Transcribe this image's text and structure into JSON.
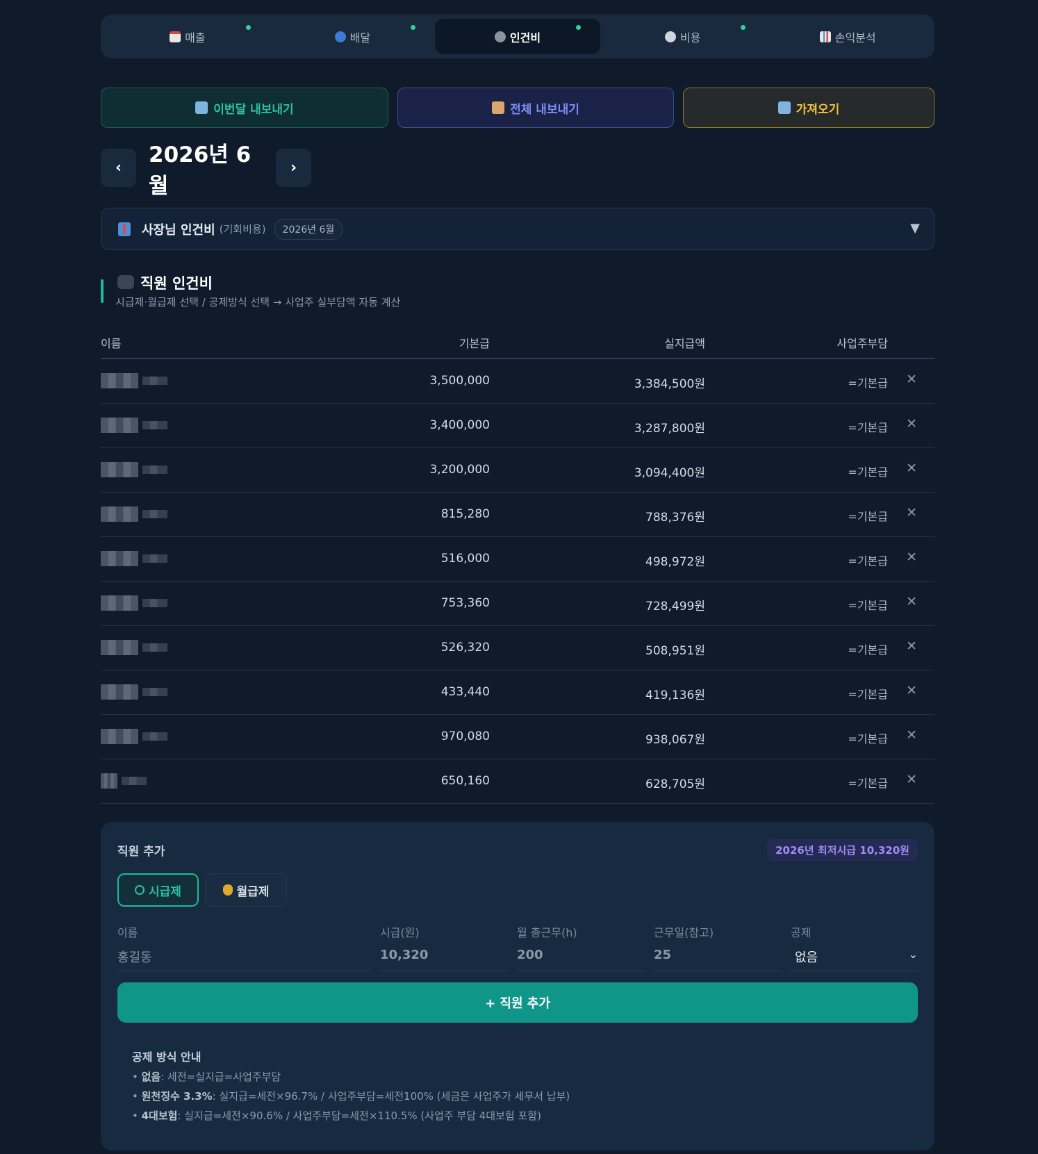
{
  "nav": {
    "tabs": [
      {
        "label": "매출",
        "active": false,
        "dot": true,
        "icon": "calendar-icon"
      },
      {
        "label": "배달",
        "active": false,
        "dot": true,
        "icon": "scooter-icon"
      },
      {
        "label": "인건비",
        "active": true,
        "dot": true,
        "icon": "people-icon"
      },
      {
        "label": "비용",
        "active": false,
        "dot": true,
        "icon": "gear-icon"
      },
      {
        "label": "손익분석",
        "active": false,
        "dot": false,
        "icon": "chart-icon"
      }
    ]
  },
  "actions": {
    "export_month": "이번달 내보내기",
    "export_all": "전체 내보내기",
    "import": "가져오기"
  },
  "month": {
    "prev": "‹",
    "label": "2026년 6월",
    "next": "›"
  },
  "owner": {
    "title": "사장님 인건비",
    "sub": "(기회비용)",
    "badge": "2026년 6월",
    "caret": "▼"
  },
  "staff_section": {
    "title": "직원 인건비",
    "subtitle": "시급제·월급제 선택 / 공제방식 선택 → 사업주 실부담액 자동 계산"
  },
  "table": {
    "headers": {
      "name": "이름",
      "base": "기본급",
      "net": "실지급액",
      "employer": "사업주부담"
    },
    "rows": [
      {
        "base": "3,500,000",
        "net": "3,384,500원",
        "employer": "=기본급"
      },
      {
        "base": "3,400,000",
        "net": "3,287,800원",
        "employer": "=기본급"
      },
      {
        "base": "3,200,000",
        "net": "3,094,400원",
        "employer": "=기본급"
      },
      {
        "base": "815,280",
        "net": "788,376원",
        "employer": "=기본급"
      },
      {
        "base": "516,000",
        "net": "498,972원",
        "employer": "=기본급"
      },
      {
        "base": "753,360",
        "net": "728,499원",
        "employer": "=기본급"
      },
      {
        "base": "526,320",
        "net": "508,951원",
        "employer": "=기본급"
      },
      {
        "base": "433,440",
        "net": "419,136원",
        "employer": "=기본급"
      },
      {
        "base": "970,080",
        "net": "938,067원",
        "employer": "=기본급"
      },
      {
        "base": "650,160",
        "net": "628,705원",
        "employer": "=기본급"
      }
    ],
    "delete_glyph": "✕"
  },
  "add_form": {
    "title": "직원 추가",
    "min_wage": "2026년 최저시급 10,320원",
    "mode_hourly": "시급제",
    "mode_monthly": "월급제",
    "labels": {
      "name": "이름",
      "wage": "시급(원)",
      "hours": "월 총근무(h)",
      "days": "근무일(참고)",
      "deduction": "공제"
    },
    "placeholders": {
      "name": "홍길동",
      "wage": "10,320",
      "hours": "200",
      "days": "25"
    },
    "deduction_value": "없음",
    "submit": "+ 직원 추가"
  },
  "guide": {
    "title": "공제 방식 안내",
    "items": [
      {
        "term": "없음",
        "desc": ": 세전=실지급=사업주부담"
      },
      {
        "term": "원천징수 3.3%",
        "desc": ": 실지급=세전×96.7% / 사업주부담=세전100% (세금은 사업주가 세무서 납부)"
      },
      {
        "term": "4대보험",
        "desc": ": 실지급=세전×90.6% / 사업주부담=세전×110.5% (사업주 부담 4대보험 포함)"
      }
    ]
  },
  "colors": {
    "accent": "#1fb89a",
    "background": "#0f1b2b",
    "panel": "#182a3f"
  }
}
